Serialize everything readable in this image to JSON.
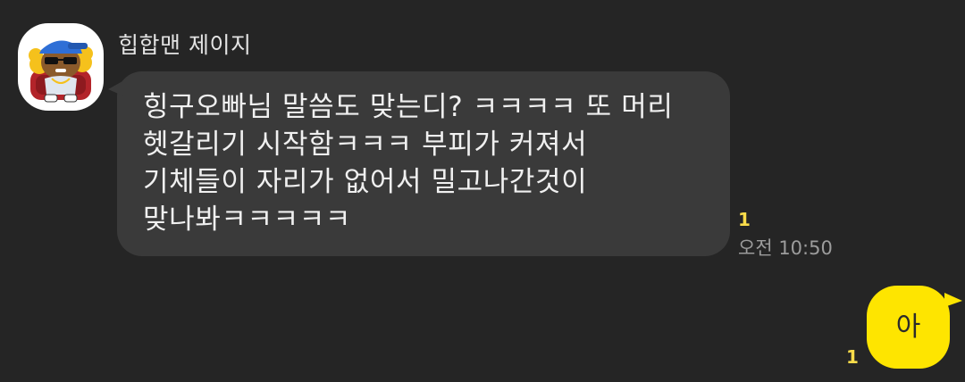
{
  "incoming": {
    "sender_name": "힙합맨 제이지",
    "avatar_icon": "rapper-character-avatar-icon",
    "lines": [
      "힝구오빠님 말씀도 맞는디? ㅋㅋㅋㅋ 또 머리",
      "헷갈리기 시작함ㅋㅋㅋ 부피가 커져서",
      "기체들이 자리가 없어서 밀고나간것이",
      "맞나봐ㅋㅋㅋㅋㅋ"
    ],
    "unread_count": "1",
    "time": "오전 10:50"
  },
  "outgoing": {
    "text": "아",
    "unread_count": "1"
  },
  "colors": {
    "background": "#252525",
    "incoming_bubble": "#3a3a3a",
    "outgoing_bubble": "#fee500",
    "unread": "#f9dc4a"
  }
}
